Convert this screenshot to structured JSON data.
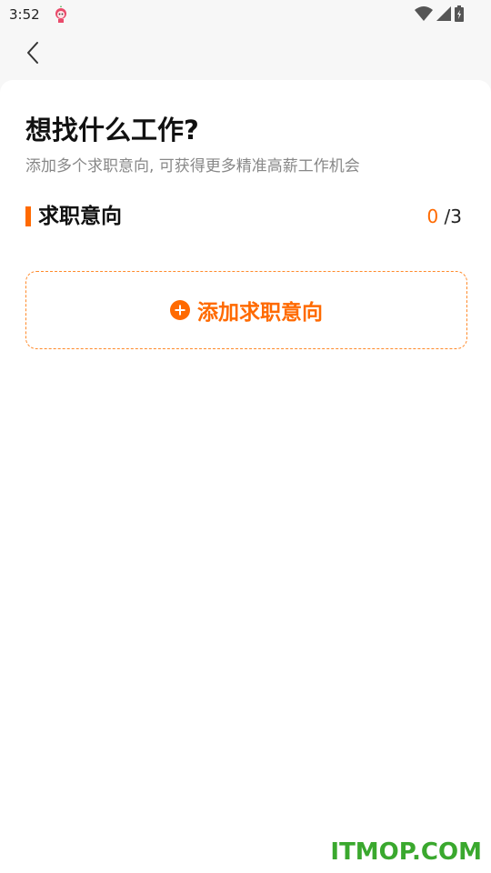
{
  "status_bar": {
    "time": "3:52",
    "icons": [
      "app-notification-icon",
      "wifi-icon",
      "signal-icon",
      "battery-charging-icon"
    ]
  },
  "nav": {
    "back_icon": "chevron-left-icon"
  },
  "header": {
    "title": "想找什么工作?",
    "subtitle": "添加多个求职意向, 可获得更多精准高薪工作机会"
  },
  "section": {
    "title": "求职意向",
    "count_current": "0",
    "count_total": "/3"
  },
  "add_button": {
    "label": "添加求职意向",
    "icon": "plus-circle-icon"
  },
  "watermark": {
    "text": "ITMOP.COM"
  },
  "colors": {
    "accent": "#ff6a00",
    "watermark": "#3aa82e",
    "background": "#f7f7f7"
  }
}
